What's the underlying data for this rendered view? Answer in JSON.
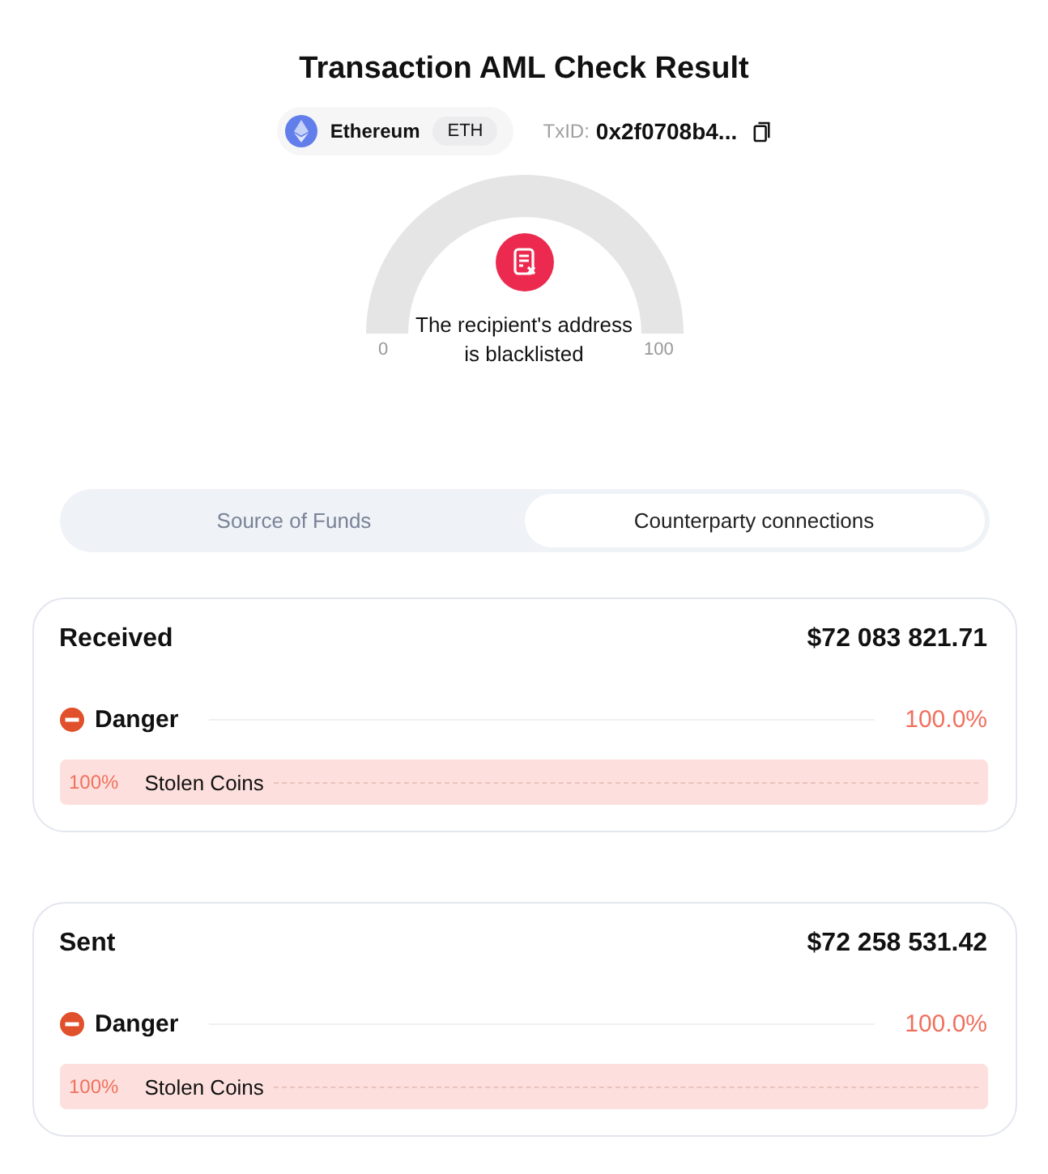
{
  "title": "Transaction AML Check Result",
  "network": {
    "name": "Ethereum",
    "ticker": "ETH"
  },
  "txid": {
    "label": "TxID:",
    "value": "0x2f0708b4..."
  },
  "gauge": {
    "min": "0",
    "max": "100",
    "message": "The recipient's address is blacklisted"
  },
  "tabs": [
    {
      "label": "Source of Funds",
      "selected": false
    },
    {
      "label": "Counterparty connections",
      "selected": true
    }
  ],
  "cards": [
    {
      "title": "Received",
      "amount": "$72 083 821.71",
      "risk": {
        "label": "Danger",
        "percent": "100.0%"
      },
      "sources": [
        {
          "percent": "100%",
          "name": "Stolen Coins"
        }
      ]
    },
    {
      "title": "Sent",
      "amount": "$72 258 531.42",
      "risk": {
        "label": "Danger",
        "percent": "100.0%"
      },
      "sources": [
        {
          "percent": "100%",
          "name": "Stolen Coins"
        }
      ]
    }
  ]
}
